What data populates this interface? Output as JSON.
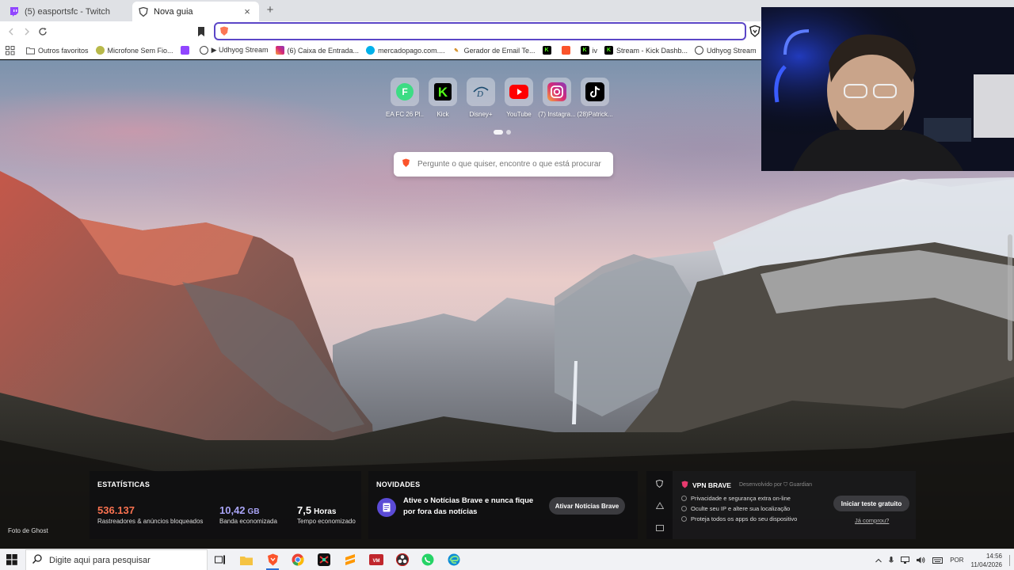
{
  "tabs": [
    {
      "title": "(5) easportsfc - Twitch",
      "active": false
    },
    {
      "title": "Nova guia",
      "active": true
    }
  ],
  "address_bar": {
    "value": ""
  },
  "bookmarks": [
    {
      "label": "Outros favoritos",
      "icon": "folder-icon"
    },
    {
      "label": "Microfone Sem Fio...",
      "icon": "mic-icon"
    },
    {
      "label": "",
      "icon": "twitch-icon"
    },
    {
      "label": "▶ Udhyog Stream",
      "icon": "globe-icon"
    },
    {
      "label": "(6) Caixa de Entrada...",
      "icon": "instagram-icon"
    },
    {
      "label": "mercadopago.com....",
      "icon": "mercadopago-icon"
    },
    {
      "label": "Gerador de Email Te...",
      "icon": "pen-icon"
    },
    {
      "label": "",
      "icon": "kick-icon"
    },
    {
      "label": "",
      "icon": "brave-icon"
    },
    {
      "label": "iv",
      "icon": "kick-icon"
    },
    {
      "label": "Stream - Kick Dashb...",
      "icon": "kick-icon"
    },
    {
      "label": "Udhyog Stream",
      "icon": "globe-icon"
    }
  ],
  "top_sites": [
    {
      "label": "EA FC 26 Pl...",
      "icon": "eafc-icon"
    },
    {
      "label": "Kick",
      "icon": "kick-icon"
    },
    {
      "label": "Disney+",
      "icon": "disney-icon"
    },
    {
      "label": "YouTube",
      "icon": "youtube-icon"
    },
    {
      "label": "(7) Instagra...",
      "icon": "instagram-icon"
    },
    {
      "label": "(28)Patrick...",
      "icon": "tiktok-icon"
    }
  ],
  "search": {
    "placeholder": "Pergunte o que quiser, encontre o que está procurar"
  },
  "photo_credit": "Foto de Ghost",
  "stats": {
    "title": "ESTATÍSTICAS",
    "items": [
      {
        "value": "536.137",
        "unit": "",
        "label": "Rastreadores & anúncios bloqueados",
        "color": "#fa7250"
      },
      {
        "value": "10,42",
        "unit": "GB",
        "label": "Banda economizada",
        "color": "#a9a4f6"
      },
      {
        "value": "7,5",
        "unit": "Horas",
        "label": "Tempo economizado",
        "color": "#ffffff"
      }
    ]
  },
  "news": {
    "title": "NOVIDADES",
    "text": "Ative o Notícias Brave e nunca fique por fora das notícias",
    "button": "Ativar Notícias Brave"
  },
  "vpn": {
    "title": "VPN BRAVE",
    "by": "Desenvolvido por",
    "provider": "Guardian",
    "features": [
      "Privacidade e segurança extra on-line",
      "Oculte seu IP e altere sua localização",
      "Proteja todos os apps do seu dispositivo"
    ],
    "button": "Iniciar teste gratuito",
    "link": "Já comprou?"
  },
  "taskbar": {
    "search_placeholder": "Digite aqui para pesquisar",
    "language": "POR",
    "time": "14:56",
    "date": "11/04/2026"
  },
  "colors": {
    "brave_orange": "#fb542b",
    "accent": "#5b46c7"
  }
}
